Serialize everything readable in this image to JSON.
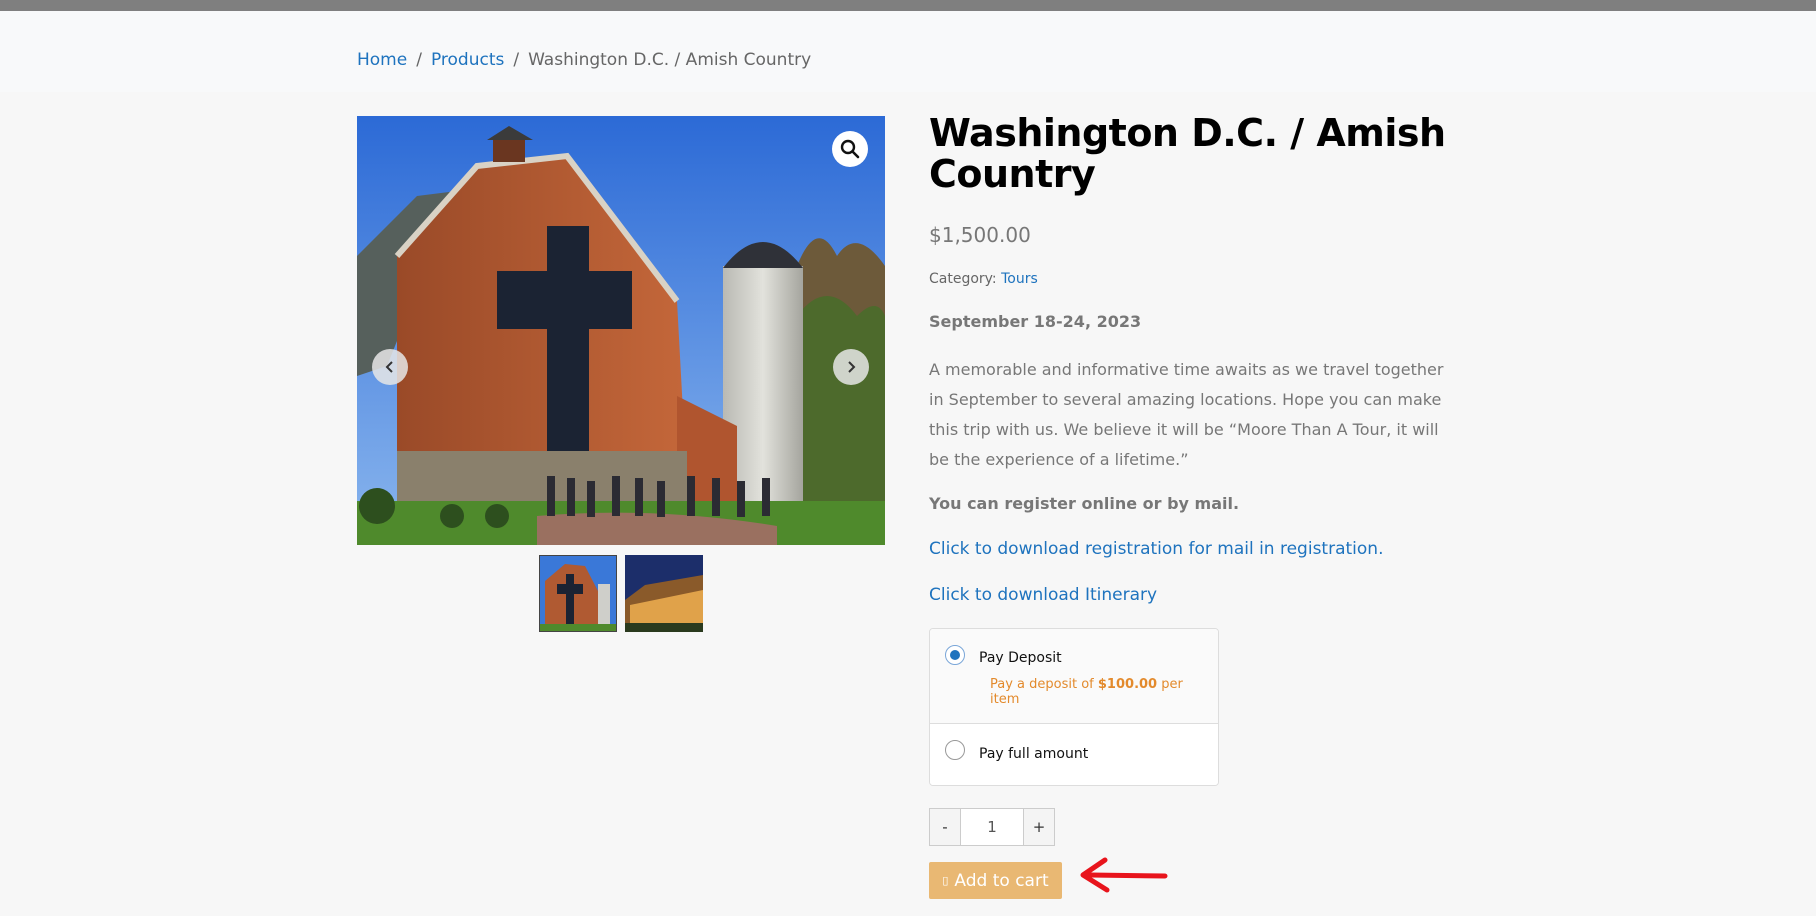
{
  "breadcrumb": {
    "home": "Home",
    "separator": "/",
    "products": "Products",
    "current": "Washington D.C. / Amish Country"
  },
  "gallery": {
    "zoom_icon": "magnifier-icon",
    "prev_icon": "chevron-left-icon",
    "next_icon": "chevron-right-icon",
    "prev_glyph": "‹",
    "next_glyph": "›",
    "zoom_glyph": "🔍",
    "thumbnails": [
      "barn-chapel-thumbnail",
      "building-night-thumbnail"
    ]
  },
  "product": {
    "title": "Washington D.C. / Amish Country",
    "price": "$1,500.00",
    "category_label": "Category:",
    "category": "Tours",
    "dates": "September 18-24, 2023",
    "description": "A memorable and informative time awaits as we travel together in September to several amazing locations. Hope you can make this trip with us. We believe it will be “Moore Than A Tour, it will be the experience of a lifetime.”",
    "register_note": "You can register online or by mail.",
    "link_registration": "Click to download registration for mail in registration.",
    "link_itinerary": "Click to download Itinerary"
  },
  "deposit": {
    "option1_label": "Pay Deposit",
    "option1_note_prefix": "Pay a deposit of",
    "option1_amount": "$100.00",
    "option1_note_suffix": "per item",
    "option2_label": "Pay full amount",
    "selected": "Pay Deposit"
  },
  "cart": {
    "minus": "-",
    "plus": "+",
    "quantity": "1",
    "add_label": "Add to cart",
    "cart_glyph": "▯"
  },
  "colors": {
    "link": "#1e73be",
    "button": "#e9b873",
    "deposit_note": "#e38a2c",
    "annotation_arrow": "#e8141c"
  }
}
